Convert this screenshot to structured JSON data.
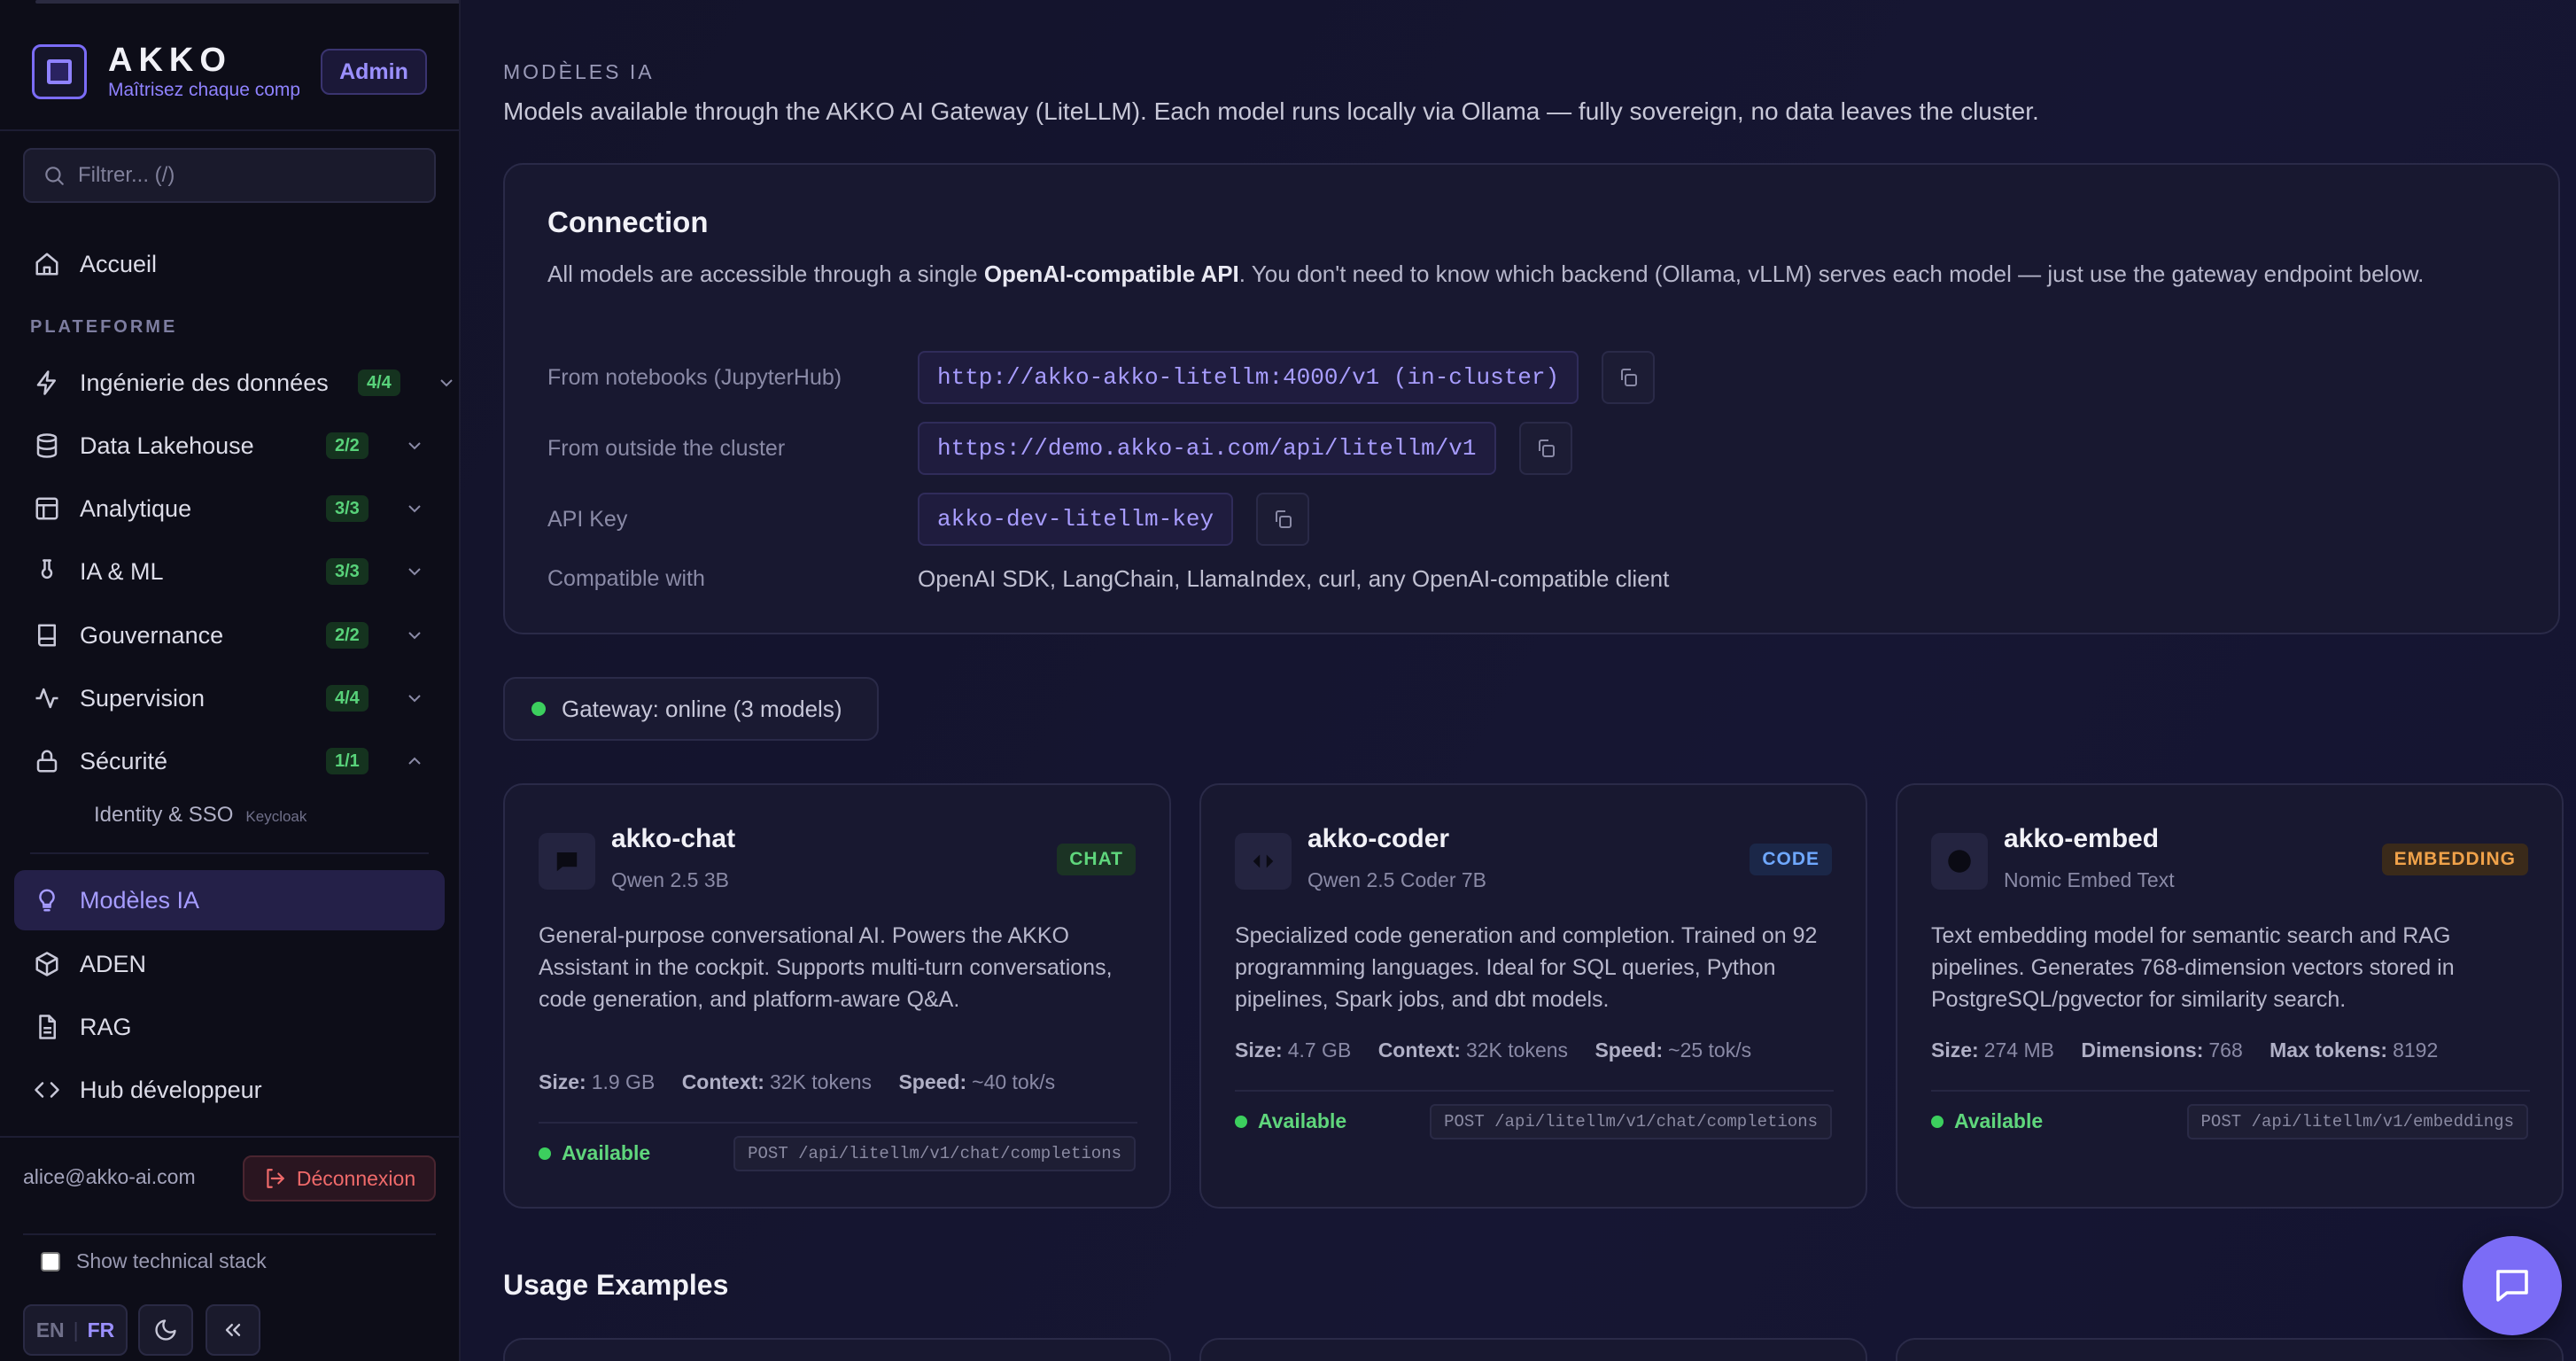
{
  "brand": {
    "name": "AKKO",
    "tagline": "Maîtrisez chaque composant",
    "role_badge": "Admin"
  },
  "sidebar": {
    "search_placeholder": "Filtrer... (/)",
    "home": "Accueil",
    "section_label": "PLATEFORME",
    "groups": [
      {
        "label": "Ingénierie des données",
        "count": "4/4",
        "icon": "lightning-icon"
      },
      {
        "label": "Data Lakehouse",
        "count": "2/2",
        "icon": "database-icon"
      },
      {
        "label": "Analytique",
        "count": "3/3",
        "icon": "layout-icon"
      },
      {
        "label": "IA & ML",
        "count": "3/3",
        "icon": "flask-icon"
      },
      {
        "label": "Gouvernance",
        "count": "2/2",
        "icon": "book-icon"
      },
      {
        "label": "Supervision",
        "count": "4/4",
        "icon": "activity-icon"
      },
      {
        "label": "Sécurité",
        "count": "1/1",
        "icon": "lock-icon"
      }
    ],
    "sub_item": {
      "label": "Identity & SSO",
      "tag": "Keycloak"
    },
    "links": [
      {
        "label": "Modèles IA",
        "active": true,
        "icon": "lightbulb-icon"
      },
      {
        "label": "ADEN",
        "active": false,
        "icon": "cube-icon"
      },
      {
        "label": "RAG",
        "active": false,
        "icon": "document-icon"
      },
      {
        "label": "Hub développeur",
        "active": false,
        "icon": "code-icon"
      }
    ],
    "user_email": "alice@akko-ai.com",
    "logout_label": "Déconnexion",
    "show_stack_label": "Show technical stack",
    "lang": {
      "en": "EN",
      "fr": "FR",
      "current": "FR"
    }
  },
  "page": {
    "kicker": "MODÈLES IA",
    "description": "Models available through the AKKO AI Gateway (LiteLLM). Each model runs locally via Ollama — fully sovereign, no data leaves the cluster."
  },
  "connection": {
    "title": "Connection",
    "intro_before": "All models are accessible through a single ",
    "intro_bold": "OpenAI-compatible API",
    "intro_after": ". You don't need to know which backend (Ollama, vLLM) serves each model — just use the gateway endpoint below.",
    "rows": [
      {
        "key": "From notebooks (JupyterHub)",
        "value": "http://akko-akko-litellm:4000/v1 (in-cluster)"
      },
      {
        "key": "From outside the cluster",
        "value": "https://demo.akko-ai.com/api/litellm/v1"
      },
      {
        "key": "API Key",
        "value": "akko-dev-litellm-key"
      }
    ],
    "compatible_key": "Compatible with",
    "compatible_value": "OpenAI SDK, LangChain, LlamaIndex, curl, any OpenAI-compatible client"
  },
  "gateway_status": "Gateway: online (3 models)",
  "models": [
    {
      "name": "akko-chat",
      "model": "Qwen 2.5 3B",
      "badge": "CHAT",
      "icon": "chat-bubble-icon",
      "badge_fg": "#5fd67c",
      "badge_bg": "#1b3324",
      "description": "General-purpose conversational AI. Powers the AKKO Assistant in the cockpit. Supports multi-turn conversations, code generation, and platform-aware Q&A.",
      "specs": [
        {
          "k": "Size:",
          "v": "1.9 GB"
        },
        {
          "k": "Context:",
          "v": "32K tokens"
        },
        {
          "k": "Speed:",
          "v": "~40 tok/s"
        }
      ],
      "status": "Available",
      "endpoint": "POST /api/litellm/v1/chat/completions"
    },
    {
      "name": "akko-coder",
      "model": "Qwen 2.5 Coder 7B",
      "badge": "CODE",
      "icon": "code-brackets-icon",
      "badge_fg": "#6fa8ff",
      "badge_bg": "#1b2748",
      "description": "Specialized code generation and completion. Trained on 92 programming languages. Ideal for SQL queries, Python pipelines, Spark jobs, and dbt models.",
      "specs": [
        {
          "k": "Size:",
          "v": "4.7 GB"
        },
        {
          "k": "Context:",
          "v": "32K tokens"
        },
        {
          "k": "Speed:",
          "v": "~25 tok/s"
        }
      ],
      "status": "Available",
      "endpoint": "POST /api/litellm/v1/chat/completions"
    },
    {
      "name": "akko-embed",
      "model": "Nomic Embed Text",
      "badge": "EMBEDDING",
      "icon": "circle-icon",
      "badge_fg": "#f0a24a",
      "badge_bg": "#3a2a1a",
      "description": "Text embedding model for semantic search and RAG pipelines. Generates 768-dimension vectors stored in PostgreSQL/pgvector for similarity search.",
      "specs": [
        {
          "k": "Size:",
          "v": "274 MB"
        },
        {
          "k": "Dimensions:",
          "v": "768"
        },
        {
          "k": "Max tokens:",
          "v": "8192"
        }
      ],
      "status": "Available",
      "endpoint": "POST /api/litellm/v1/embeddings"
    }
  ],
  "usage_title": "Usage Examples",
  "colors": {
    "accent": "#7b6cf6",
    "success": "#3ccf5e",
    "danger": "#f06a6a",
    "bg": "#13132a",
    "sidebar_bg": "#0d0d18"
  }
}
